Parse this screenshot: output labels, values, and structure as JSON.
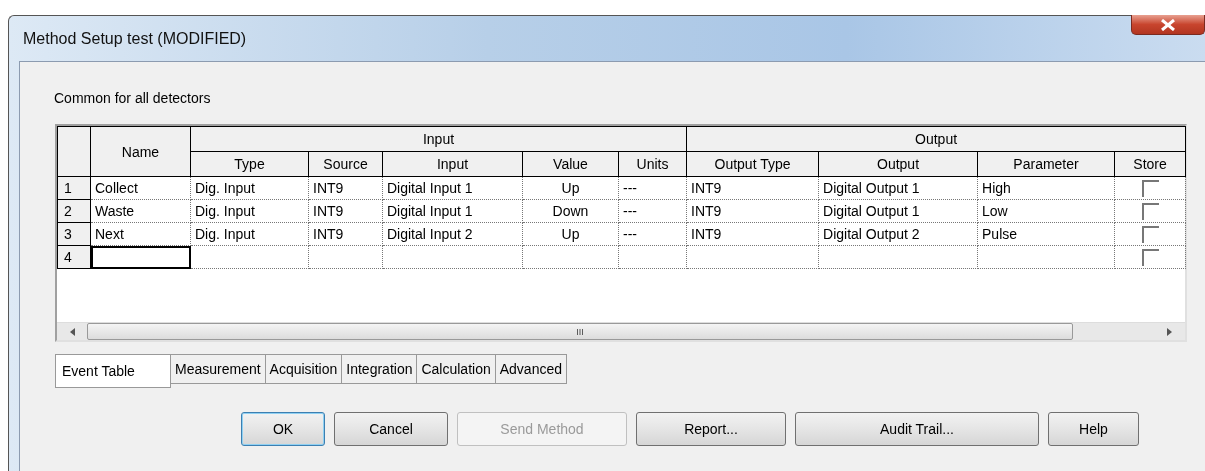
{
  "window": {
    "title": "Method Setup test (MODIFIED)"
  },
  "section_label": "Common for all detectors",
  "table": {
    "name_column": "Name",
    "column_groups": [
      {
        "label": "Input",
        "columns": [
          "Type",
          "Source",
          "Input",
          "Value",
          "Units"
        ]
      },
      {
        "label": "Output",
        "columns": [
          "Output Type",
          "Output",
          "Parameter",
          "Store"
        ]
      }
    ],
    "rows": [
      {
        "number": "1",
        "cells": [
          "Collect",
          "Dig. Input",
          "INT9",
          "Digital Input 1",
          "Up",
          "---",
          "INT9",
          "Digital Output 1",
          "High"
        ],
        "store_checked": false,
        "focused": false
      },
      {
        "number": "2",
        "cells": [
          "Waste",
          "Dig. Input",
          "INT9",
          "Digital Input 1",
          "Down",
          "---",
          "INT9",
          "Digital Output 1",
          "Low"
        ],
        "store_checked": false,
        "focused": false
      },
      {
        "number": "3",
        "cells": [
          "Next",
          "Dig. Input",
          "INT9",
          "Digital Input 2",
          "Up",
          "---",
          "INT9",
          "Digital Output 2",
          "Pulse"
        ],
        "store_checked": false,
        "focused": false
      },
      {
        "number": "4",
        "cells": [],
        "store_checked": false,
        "focused": true
      }
    ]
  },
  "scroll_grip": "III",
  "tabs": [
    {
      "label": "Event Table",
      "selected": true
    },
    {
      "label": "Measurement",
      "selected": false
    },
    {
      "label": "Acquisition",
      "selected": false
    },
    {
      "label": "Integration",
      "selected": false
    },
    {
      "label": "Calculation",
      "selected": false
    },
    {
      "label": "Advanced",
      "selected": false
    }
  ],
  "buttons": [
    {
      "label": "OK",
      "default": true,
      "disabled": false
    },
    {
      "label": "Cancel",
      "default": false,
      "disabled": false
    },
    {
      "label": "Send Method",
      "default": false,
      "disabled": true
    },
    {
      "label": "Report...",
      "default": false,
      "disabled": false
    },
    {
      "label": "Audit Trail...",
      "default": false,
      "disabled": false
    },
    {
      "label": "Help",
      "default": false,
      "disabled": false
    }
  ]
}
